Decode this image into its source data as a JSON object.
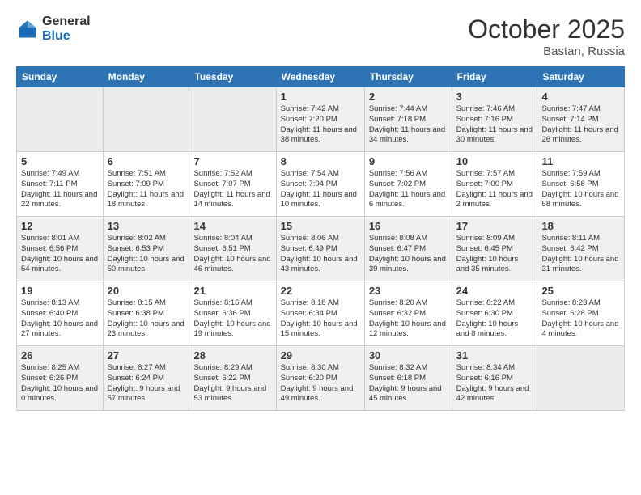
{
  "logo": {
    "general": "General",
    "blue": "Blue"
  },
  "header": {
    "month": "October 2025",
    "location": "Bastan, Russia"
  },
  "weekdays": [
    "Sunday",
    "Monday",
    "Tuesday",
    "Wednesday",
    "Thursday",
    "Friday",
    "Saturday"
  ],
  "weeks": [
    [
      {
        "day": "",
        "info": ""
      },
      {
        "day": "",
        "info": ""
      },
      {
        "day": "",
        "info": ""
      },
      {
        "day": "1",
        "info": "Sunrise: 7:42 AM\nSunset: 7:20 PM\nDaylight: 11 hours and 38 minutes."
      },
      {
        "day": "2",
        "info": "Sunrise: 7:44 AM\nSunset: 7:18 PM\nDaylight: 11 hours and 34 minutes."
      },
      {
        "day": "3",
        "info": "Sunrise: 7:46 AM\nSunset: 7:16 PM\nDaylight: 11 hours and 30 minutes."
      },
      {
        "day": "4",
        "info": "Sunrise: 7:47 AM\nSunset: 7:14 PM\nDaylight: 11 hours and 26 minutes."
      }
    ],
    [
      {
        "day": "5",
        "info": "Sunrise: 7:49 AM\nSunset: 7:11 PM\nDaylight: 11 hours and 22 minutes."
      },
      {
        "day": "6",
        "info": "Sunrise: 7:51 AM\nSunset: 7:09 PM\nDaylight: 11 hours and 18 minutes."
      },
      {
        "day": "7",
        "info": "Sunrise: 7:52 AM\nSunset: 7:07 PM\nDaylight: 11 hours and 14 minutes."
      },
      {
        "day": "8",
        "info": "Sunrise: 7:54 AM\nSunset: 7:04 PM\nDaylight: 11 hours and 10 minutes."
      },
      {
        "day": "9",
        "info": "Sunrise: 7:56 AM\nSunset: 7:02 PM\nDaylight: 11 hours and 6 minutes."
      },
      {
        "day": "10",
        "info": "Sunrise: 7:57 AM\nSunset: 7:00 PM\nDaylight: 11 hours and 2 minutes."
      },
      {
        "day": "11",
        "info": "Sunrise: 7:59 AM\nSunset: 6:58 PM\nDaylight: 10 hours and 58 minutes."
      }
    ],
    [
      {
        "day": "12",
        "info": "Sunrise: 8:01 AM\nSunset: 6:56 PM\nDaylight: 10 hours and 54 minutes."
      },
      {
        "day": "13",
        "info": "Sunrise: 8:02 AM\nSunset: 6:53 PM\nDaylight: 10 hours and 50 minutes."
      },
      {
        "day": "14",
        "info": "Sunrise: 8:04 AM\nSunset: 6:51 PM\nDaylight: 10 hours and 46 minutes."
      },
      {
        "day": "15",
        "info": "Sunrise: 8:06 AM\nSunset: 6:49 PM\nDaylight: 10 hours and 43 minutes."
      },
      {
        "day": "16",
        "info": "Sunrise: 8:08 AM\nSunset: 6:47 PM\nDaylight: 10 hours and 39 minutes."
      },
      {
        "day": "17",
        "info": "Sunrise: 8:09 AM\nSunset: 6:45 PM\nDaylight: 10 hours and 35 minutes."
      },
      {
        "day": "18",
        "info": "Sunrise: 8:11 AM\nSunset: 6:42 PM\nDaylight: 10 hours and 31 minutes."
      }
    ],
    [
      {
        "day": "19",
        "info": "Sunrise: 8:13 AM\nSunset: 6:40 PM\nDaylight: 10 hours and 27 minutes."
      },
      {
        "day": "20",
        "info": "Sunrise: 8:15 AM\nSunset: 6:38 PM\nDaylight: 10 hours and 23 minutes."
      },
      {
        "day": "21",
        "info": "Sunrise: 8:16 AM\nSunset: 6:36 PM\nDaylight: 10 hours and 19 minutes."
      },
      {
        "day": "22",
        "info": "Sunrise: 8:18 AM\nSunset: 6:34 PM\nDaylight: 10 hours and 15 minutes."
      },
      {
        "day": "23",
        "info": "Sunrise: 8:20 AM\nSunset: 6:32 PM\nDaylight: 10 hours and 12 minutes."
      },
      {
        "day": "24",
        "info": "Sunrise: 8:22 AM\nSunset: 6:30 PM\nDaylight: 10 hours and 8 minutes."
      },
      {
        "day": "25",
        "info": "Sunrise: 8:23 AM\nSunset: 6:28 PM\nDaylight: 10 hours and 4 minutes."
      }
    ],
    [
      {
        "day": "26",
        "info": "Sunrise: 8:25 AM\nSunset: 6:26 PM\nDaylight: 10 hours and 0 minutes."
      },
      {
        "day": "27",
        "info": "Sunrise: 8:27 AM\nSunset: 6:24 PM\nDaylight: 9 hours and 57 minutes."
      },
      {
        "day": "28",
        "info": "Sunrise: 8:29 AM\nSunset: 6:22 PM\nDaylight: 9 hours and 53 minutes."
      },
      {
        "day": "29",
        "info": "Sunrise: 8:30 AM\nSunset: 6:20 PM\nDaylight: 9 hours and 49 minutes."
      },
      {
        "day": "30",
        "info": "Sunrise: 8:32 AM\nSunset: 6:18 PM\nDaylight: 9 hours and 45 minutes."
      },
      {
        "day": "31",
        "info": "Sunrise: 8:34 AM\nSunset: 6:16 PM\nDaylight: 9 hours and 42 minutes."
      },
      {
        "day": "",
        "info": ""
      }
    ]
  ]
}
